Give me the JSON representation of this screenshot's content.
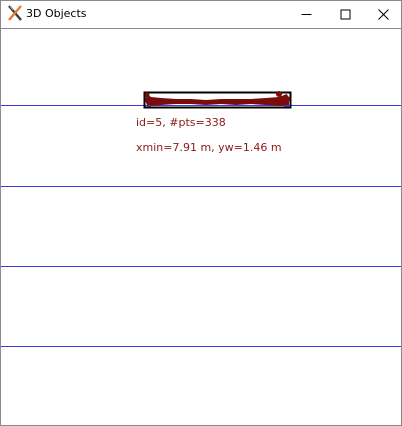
{
  "window": {
    "title": "3D Objects",
    "icon": "matplotlib-x-icon",
    "controls": [
      "minimize",
      "maximize",
      "close"
    ]
  },
  "colors": {
    "grid_line": "#3b3bd8",
    "object_fill": "#7a0c0c",
    "object_outline": "#000000",
    "label_text": "#8b1a1a"
  },
  "scene": {
    "object": {
      "id_label": "id=5, #pts=338",
      "dims_label": "xmin=7.91 m, yw=1.46 m"
    }
  }
}
